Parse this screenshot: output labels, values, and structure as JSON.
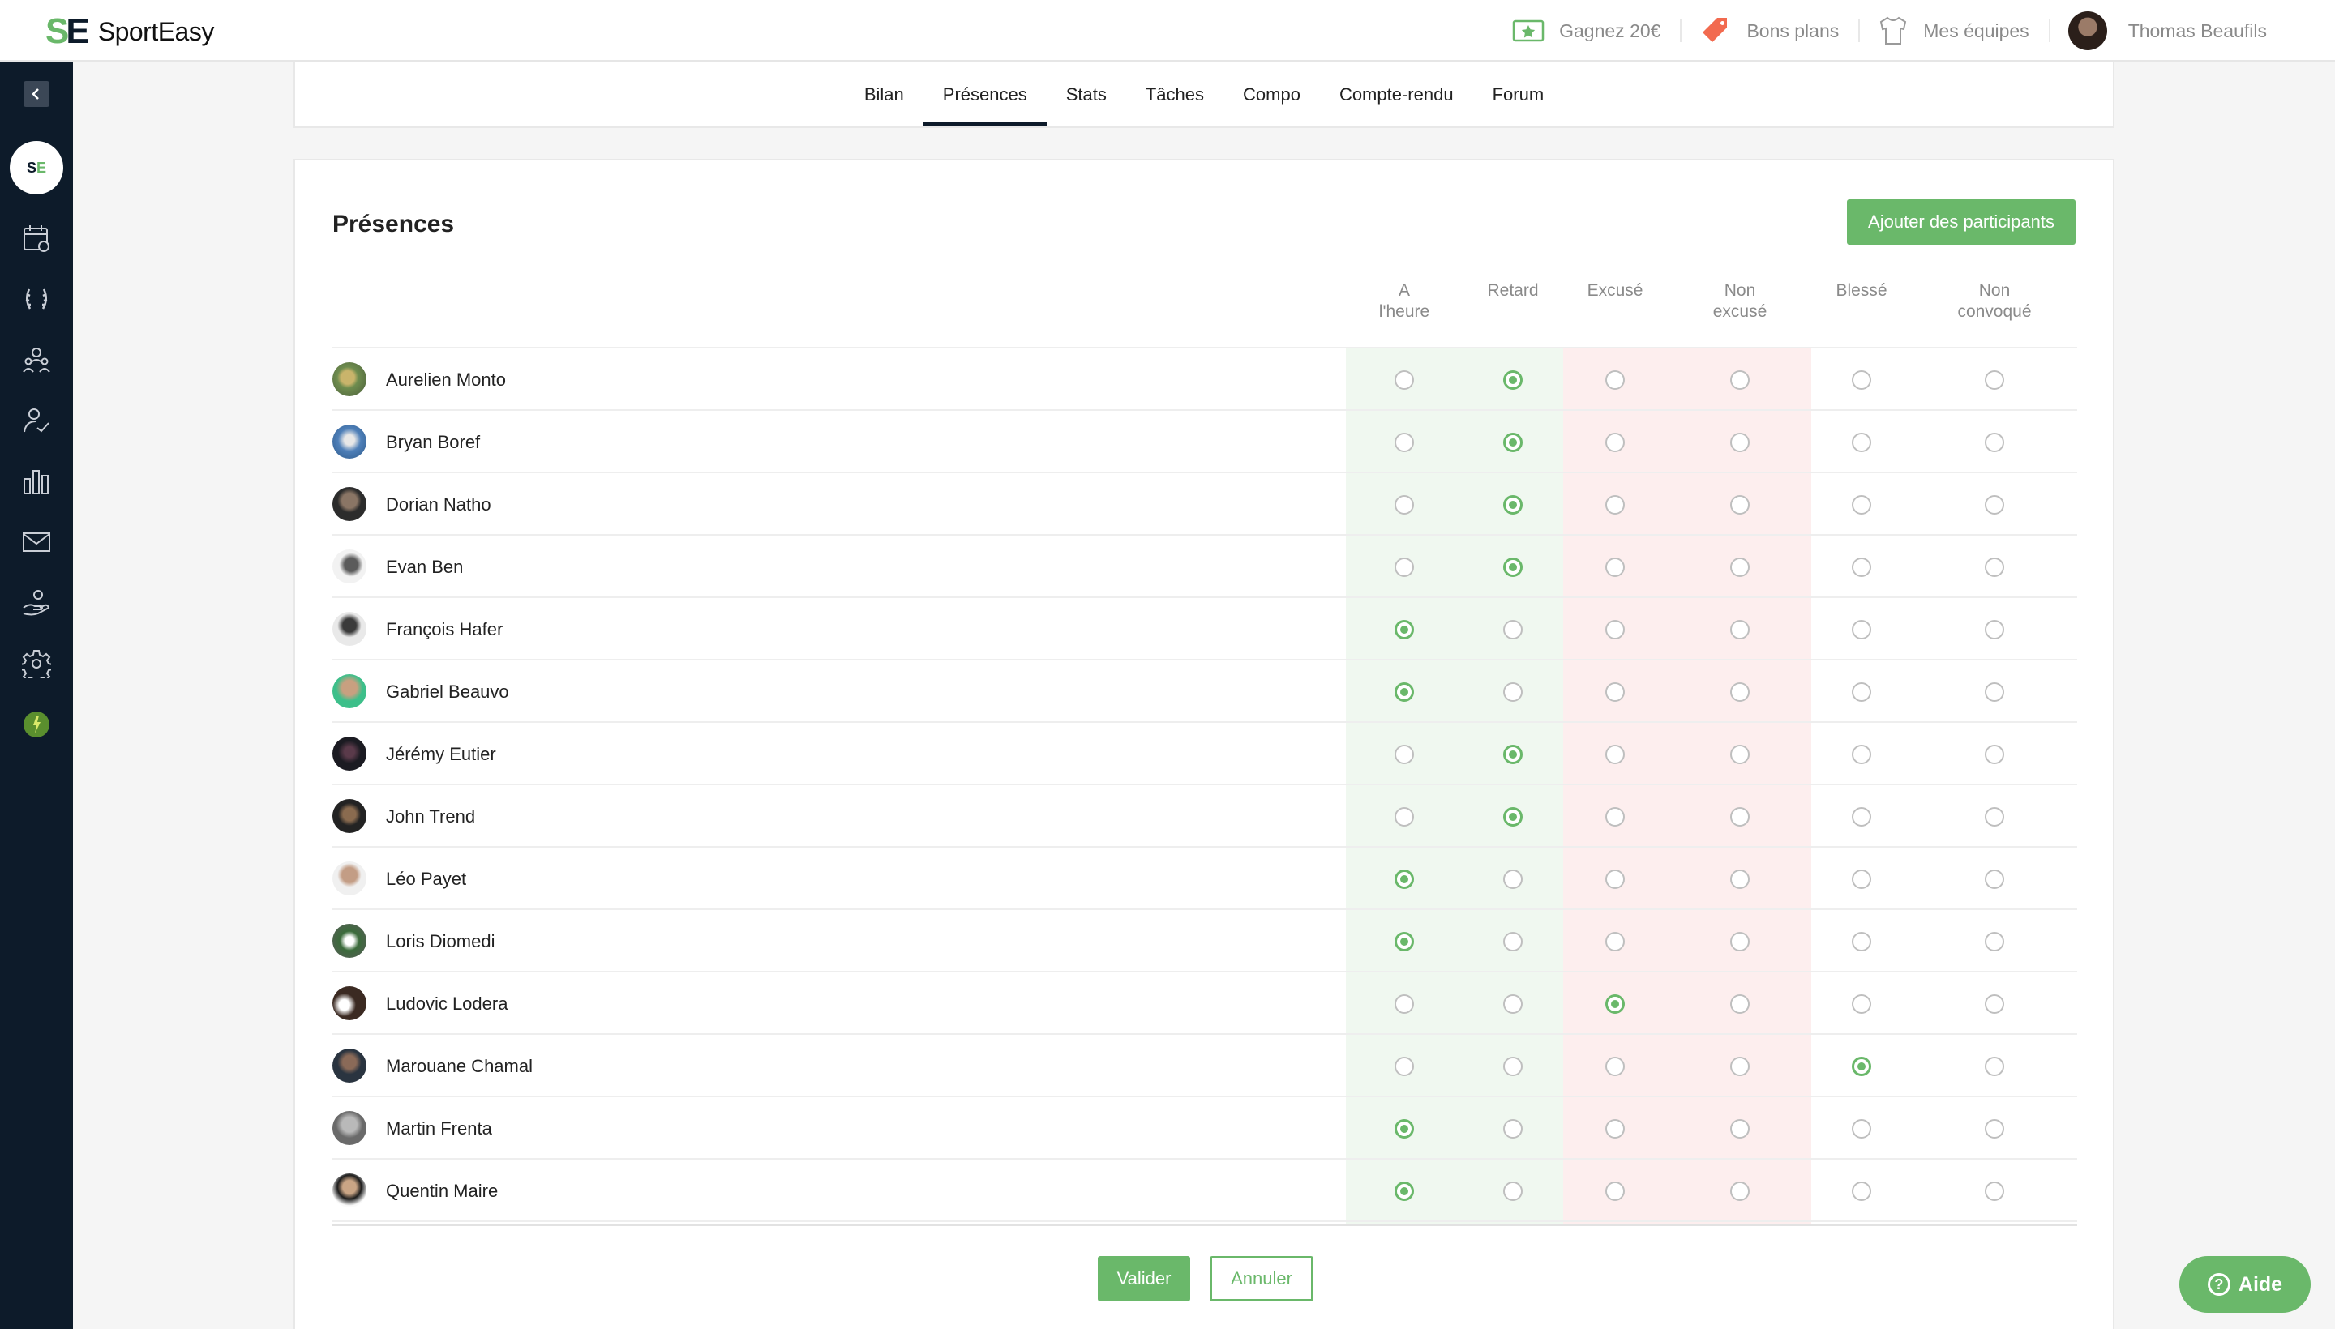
{
  "brand": {
    "name": "SportEasy",
    "accent": "#6ab86a",
    "dark": "#0d1b2a"
  },
  "topbar": {
    "earn": {
      "label": "Gagnez 20€",
      "icon": "ticket-star-icon"
    },
    "deals": {
      "label": "Bons plans",
      "icon": "price-tag-icon"
    },
    "teams": {
      "label": "Mes équipes",
      "icon": "jersey-icon"
    },
    "user": {
      "name": "Thomas Beaufils",
      "icon": "avatar"
    }
  },
  "sidebar": {
    "items": [
      {
        "name": "calendar-icon"
      },
      {
        "name": "laurel-icon"
      },
      {
        "name": "team-members-icon"
      },
      {
        "name": "attendance-check-icon"
      },
      {
        "name": "stats-icon"
      },
      {
        "name": "mail-icon"
      },
      {
        "name": "hand-money-icon"
      },
      {
        "name": "gear-icon"
      },
      {
        "name": "club-badge-icon"
      }
    ]
  },
  "tabs": [
    "Bilan",
    "Présences",
    "Stats",
    "Tâches",
    "Compo",
    "Compte-rendu",
    "Forum"
  ],
  "active_tab": "Présences",
  "attendance": {
    "title": "Présences",
    "add_button": "Ajouter des participants",
    "columns": [
      {
        "l1": "A",
        "l2": "l'heure"
      },
      {
        "l1": "Retard",
        "l2": ""
      },
      {
        "l1": "Excusé",
        "l2": ""
      },
      {
        "l1": "Non",
        "l2": "excusé"
      },
      {
        "l1": "Blessé",
        "l2": ""
      },
      {
        "l1": "Non",
        "l2": "convoqué"
      }
    ],
    "players": [
      {
        "name": "Aurelien Monto",
        "status": 1
      },
      {
        "name": "Bryan Boref",
        "status": 1
      },
      {
        "name": "Dorian Natho",
        "status": 1
      },
      {
        "name": "Evan Ben",
        "status": 1
      },
      {
        "name": "François Hafer",
        "status": 0
      },
      {
        "name": "Gabriel Beauvo",
        "status": 0
      },
      {
        "name": "Jérémy Eutier",
        "status": 1
      },
      {
        "name": "John Trend",
        "status": 1
      },
      {
        "name": "Léo Payet",
        "status": 0
      },
      {
        "name": "Loris Diomedi",
        "status": 0
      },
      {
        "name": "Ludovic Lodera",
        "status": 2
      },
      {
        "name": "Marouane Chamal",
        "status": 4
      },
      {
        "name": "Martin Frenta",
        "status": 0
      },
      {
        "name": "Quentin Maire",
        "status": 0
      }
    ],
    "validate_button": "Valider",
    "cancel_button": "Annuler"
  },
  "help_button": "Aide"
}
